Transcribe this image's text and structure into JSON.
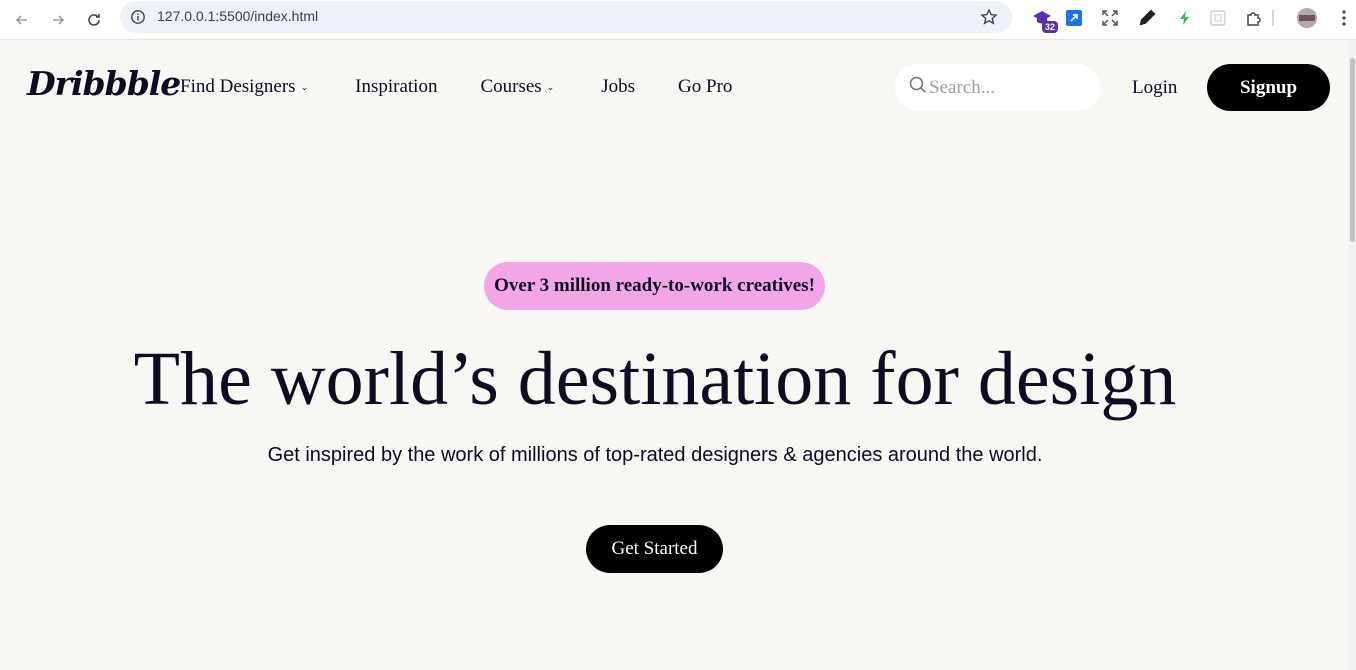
{
  "browser": {
    "url": "127.0.0.1:5500/index.html",
    "extension_badge": "32"
  },
  "header": {
    "logo": "Dribbble",
    "nav": [
      {
        "label": "Find Designers",
        "has_dropdown": true
      },
      {
        "label": "Inspiration",
        "has_dropdown": false
      },
      {
        "label": "Courses",
        "has_dropdown": true
      },
      {
        "label": "Jobs",
        "has_dropdown": false
      },
      {
        "label": "Go Pro",
        "has_dropdown": false
      }
    ],
    "search_placeholder": "Search...",
    "login_label": "Login",
    "signup_label": "Signup"
  },
  "hero": {
    "badge": "Over 3 million ready-to-work creatives!",
    "title": "The world’s destination for design",
    "subtitle": "Get inspired by the work of millions of top-rated designers & agencies around the world.",
    "cta_label": "Get Started"
  },
  "colors": {
    "background": "#f8f7f4",
    "badge_bg": "#f3a6e6",
    "button_bg": "#000000",
    "text": "#0d0c22"
  }
}
